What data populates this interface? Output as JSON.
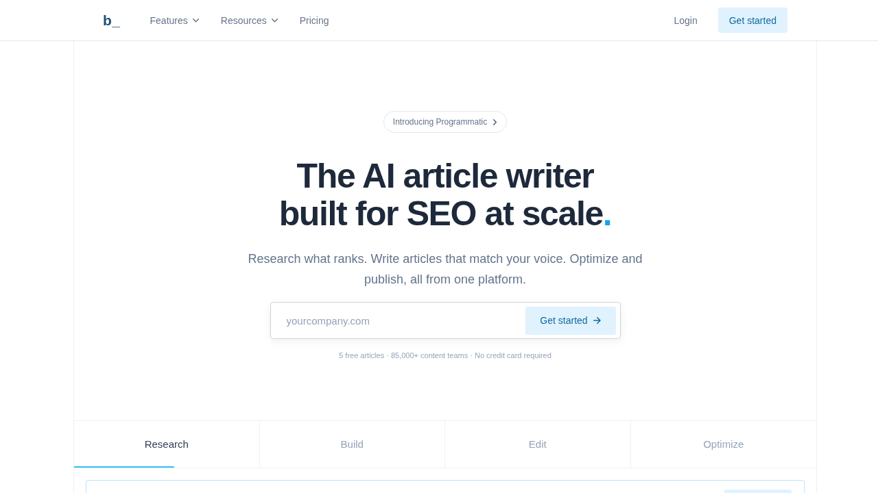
{
  "header": {
    "logo": "b_",
    "nav": [
      {
        "label": "Features",
        "kind": "dropdown"
      },
      {
        "label": "Resources",
        "kind": "dropdown"
      },
      {
        "label": "Pricing",
        "kind": "link"
      }
    ],
    "login": "Login",
    "cta": "Get started"
  },
  "hero": {
    "announcement": "Introducing Programmatic",
    "title_lines": [
      "The AI article writer",
      "built for SEO at scale"
    ],
    "title_accent": ".",
    "subtitle": "Research what ranks. Write articles that match your voice. Optimize and publish, all from one platform.",
    "signup": {
      "placeholder": "yourcompany.com",
      "button": "Get started"
    },
    "note": "5 free articles · 85,000+ content teams · No credit card required"
  },
  "tabs": {
    "items": [
      {
        "label": "Research",
        "selected": true
      },
      {
        "label": "Build",
        "selected": false
      },
      {
        "label": "Edit",
        "selected": false
      },
      {
        "label": "Optimize",
        "selected": false
      }
    ],
    "progress": {
      "level": 0.54
    }
  }
}
